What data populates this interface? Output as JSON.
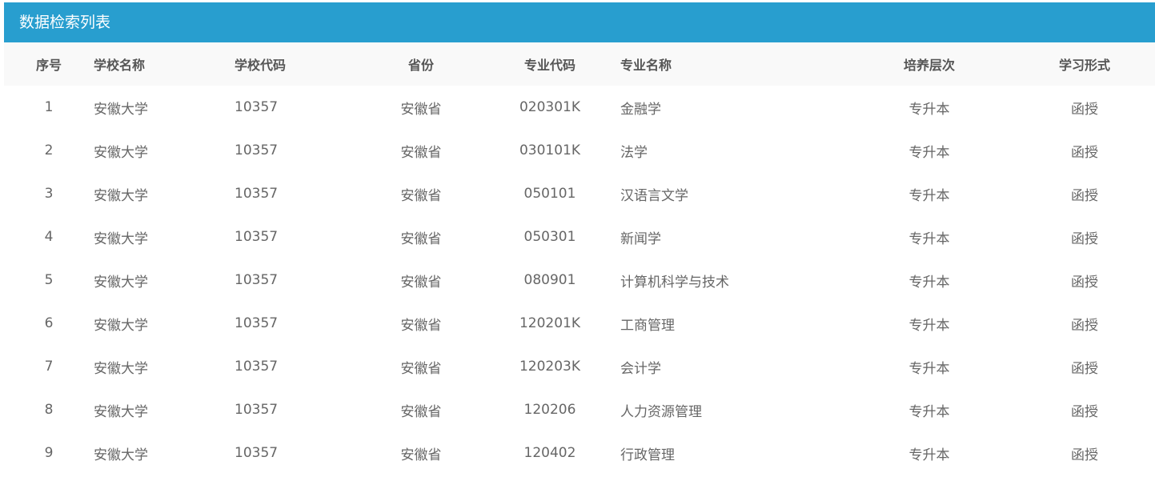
{
  "panel": {
    "title": "数据检索列表"
  },
  "table": {
    "headers": [
      "序号",
      "学校名称",
      "学校代码",
      "省份",
      "专业代码",
      "专业名称",
      "培养层次",
      "学习形式"
    ],
    "rows": [
      [
        "1",
        "安徽大学",
        "10357",
        "安徽省",
        "020301K",
        "金融学",
        "专升本",
        "函授"
      ],
      [
        "2",
        "安徽大学",
        "10357",
        "安徽省",
        "030101K",
        "法学",
        "专升本",
        "函授"
      ],
      [
        "3",
        "安徽大学",
        "10357",
        "安徽省",
        "050101",
        "汉语言文学",
        "专升本",
        "函授"
      ],
      [
        "4",
        "安徽大学",
        "10357",
        "安徽省",
        "050301",
        "新闻学",
        "专升本",
        "函授"
      ],
      [
        "5",
        "安徽大学",
        "10357",
        "安徽省",
        "080901",
        "计算机科学与技术",
        "专升本",
        "函授"
      ],
      [
        "6",
        "安徽大学",
        "10357",
        "安徽省",
        "120201K",
        "工商管理",
        "专升本",
        "函授"
      ],
      [
        "7",
        "安徽大学",
        "10357",
        "安徽省",
        "120203K",
        "会计学",
        "专升本",
        "函授"
      ],
      [
        "8",
        "安徽大学",
        "10357",
        "安徽省",
        "120206",
        "人力资源管理",
        "专升本",
        "函授"
      ],
      [
        "9",
        "安徽大学",
        "10357",
        "安徽省",
        "120402",
        "行政管理",
        "专升本",
        "函授"
      ]
    ]
  },
  "colors": {
    "header_bar": "#289ecf",
    "table_head_bg": "#f9f9f9",
    "text": "#666666"
  }
}
